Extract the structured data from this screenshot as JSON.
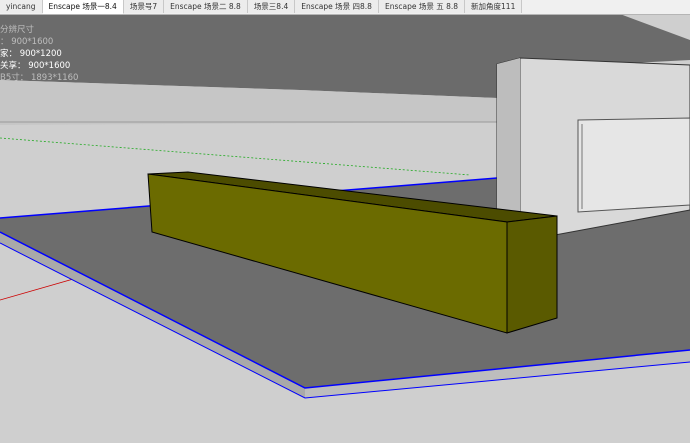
{
  "tabs": [
    {
      "label": "yincang"
    },
    {
      "label": "Enscape 场景一8.4"
    },
    {
      "label": "场景号7"
    },
    {
      "label": "Enscape 场景二 8.8"
    },
    {
      "label": "场景三8.4"
    },
    {
      "label": "Enscape 场景 四8.8"
    },
    {
      "label": "Enscape 场景 五 8.8"
    },
    {
      "label": "新加角度111"
    }
  ],
  "overlay": {
    "line1": "分辨尺寸",
    "line2": "：  900*1600",
    "line3": "家：  900*1200",
    "line4": "关享：  900*1600",
    "line5": "B5寸：  1893*1160"
  },
  "colors": {
    "sky": "#cfcfcf",
    "background_wall": "#6b6b6b",
    "ground": "#6e6e6e",
    "slab_edge": "#bdbdbd",
    "beam_front": "#6b6b00",
    "beam_top": "#4c4c00",
    "beam_end": "#5a5a00",
    "building": "#d9d9d9",
    "selection_outline": "#0000ff",
    "axis_red": "#cc0000",
    "axis_green": "#00a000"
  }
}
